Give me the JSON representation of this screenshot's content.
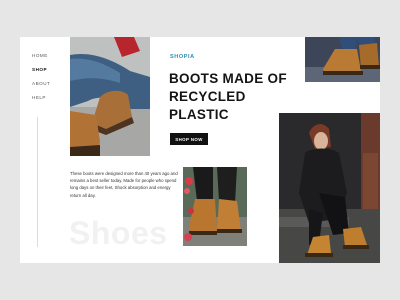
{
  "nav": {
    "items": [
      {
        "label": "HOME",
        "active": false
      },
      {
        "label": "SHOP",
        "active": true
      },
      {
        "label": "ABOUT",
        "active": false
      },
      {
        "label": "HELP",
        "active": false
      }
    ]
  },
  "hero": {
    "brand": "SHOPIA",
    "headline": "BOOTS MADE OF RECYCLED PLASTIC",
    "cta_label": "SHOP NOW"
  },
  "description": "These boots were designed more than 40 years ago and remains a best seller today. Made for people who spend long days on their feet, Shock absorption and energy return all day.",
  "watermark": "Shoes",
  "colors": {
    "accent": "#2b8fb3",
    "button": "#111111",
    "page_bg": "#e6e6e6",
    "card_bg": "#ffffff"
  }
}
